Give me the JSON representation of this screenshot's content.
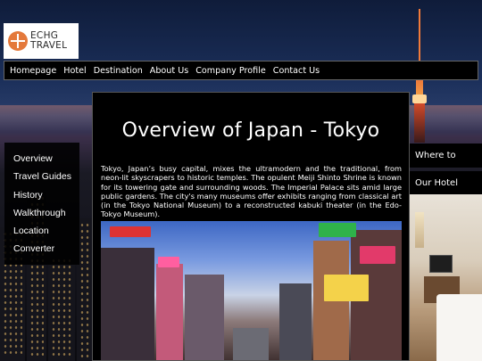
{
  "brand": {
    "logo_text_line1": "ECHG",
    "logo_text_line2": "TRAVEL"
  },
  "nav": {
    "items": [
      "Homepage",
      "Hotel",
      "Destination",
      "About Us",
      "Company Profile",
      "Contact Us"
    ]
  },
  "sidebar": {
    "items": [
      "Overview",
      "Travel Guides",
      "History",
      "Walkthrough",
      "Location",
      "Converter"
    ]
  },
  "main": {
    "title": "Overview of Japan - Tokyo",
    "body": "Tokyo, Japan’s busy capital, mixes the ultramodern and the traditional, from neon-lit skyscrapers to historic temples. The opulent Meiji Shinto Shrine is known for its towering gate and surrounding woods. The Imperial Palace sits amid large public gardens. The city's many museums offer exhibits ranging from classical art (in the Tokyo National Museum) to a reconstructed kabuki theater (in the Edo-Tokyo Museum)."
  },
  "right_panel": {
    "where_to_stay": "Where to stay?",
    "our_hotel": "Our Hotel page"
  },
  "colors": {
    "logo_accent": "#e4793b",
    "panel_bg": "#000000",
    "text": "#ffffff"
  }
}
